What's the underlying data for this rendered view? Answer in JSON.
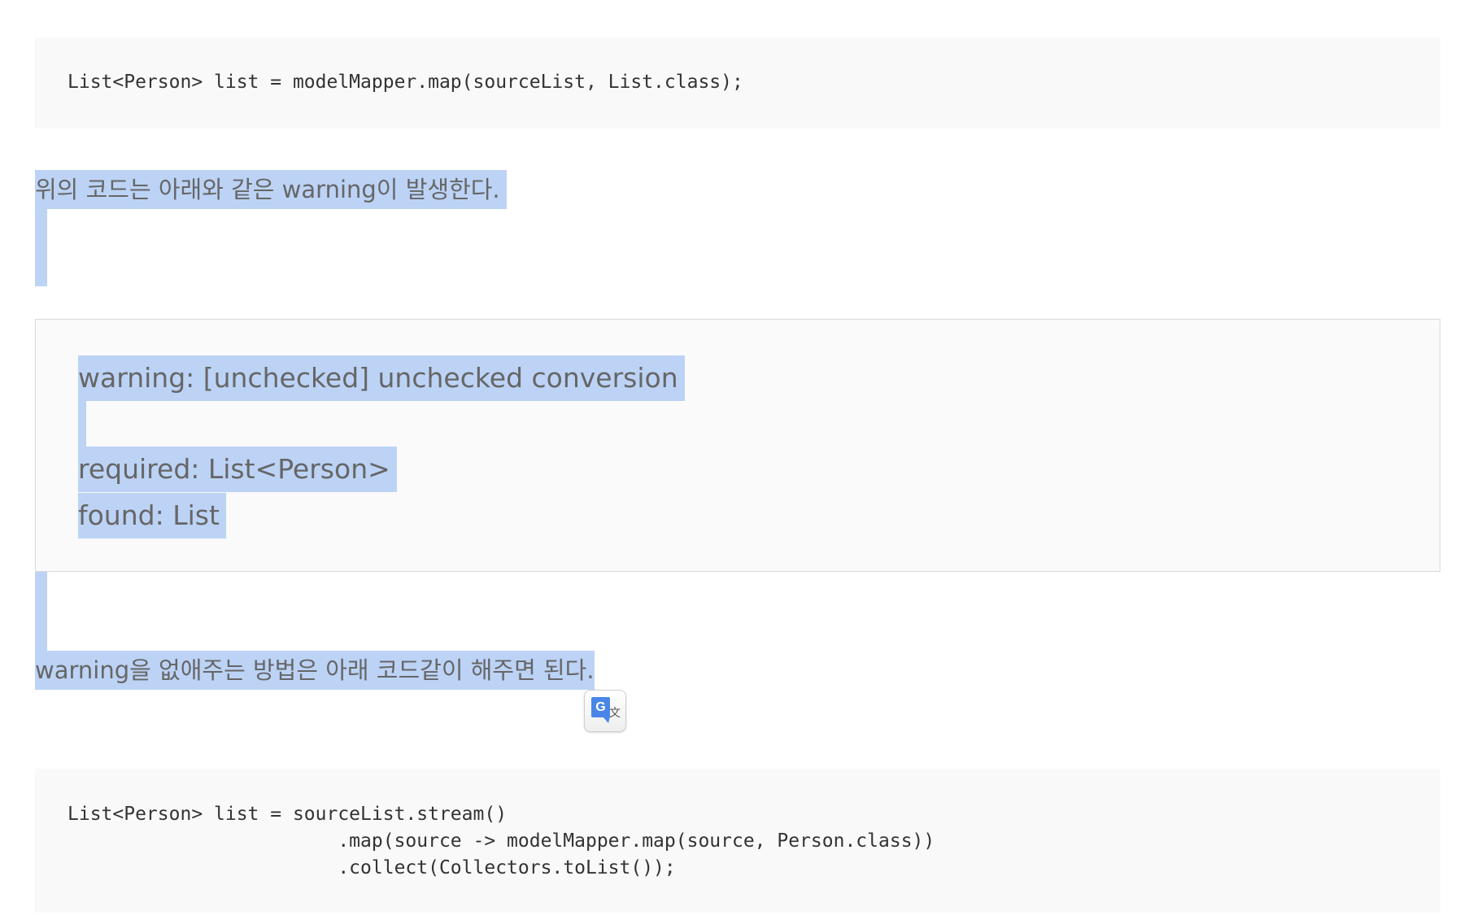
{
  "code_block_1": {
    "lines": "List<Person> list = modelMapper.map(sourceList, List.class);"
  },
  "paragraph_1": "위의 코드는 아래와 같은 warning이 발생한다.",
  "warning_box": {
    "line_1": "warning: [unchecked] unchecked conversion",
    "line_2": "required: List<Person>",
    "line_3": "found: List"
  },
  "paragraph_2": "warning을 없애주는 방법은 아래 코드같이 해주면 된다.",
  "translate_button": {
    "icon": "google-translate-icon",
    "g_label": "G",
    "wen_label": "文"
  },
  "code_block_2": {
    "lines": "List<Person> list = sourceList.stream()\n                        .map(source -> modelMapper.map(source, Person.class))\n                        .collect(Collectors.toList());"
  },
  "colors": {
    "selection": "#bcd3f6",
    "code_background": "#f9f9f9",
    "text": "#666666",
    "code_text": "#333333",
    "translate_blue": "#4a86e8"
  }
}
